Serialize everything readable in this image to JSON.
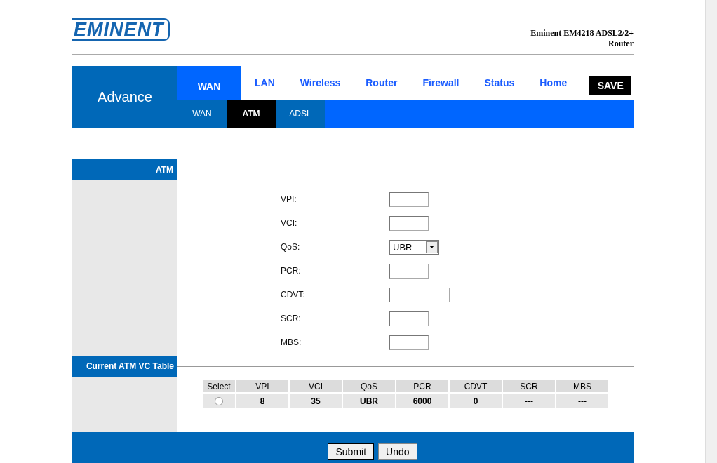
{
  "logo": "EMINENT",
  "product_title": "Eminent EM4218 ADSL2/2+ Router",
  "section_label": "Advance",
  "tabs": [
    {
      "label": "WAN",
      "selected": true
    },
    {
      "label": "LAN",
      "selected": false
    },
    {
      "label": "Wireless",
      "selected": false
    },
    {
      "label": "Router",
      "selected": false
    },
    {
      "label": "Firewall",
      "selected": false
    },
    {
      "label": "Status",
      "selected": false
    },
    {
      "label": "Home",
      "selected": false
    }
  ],
  "save_button": "SAVE",
  "subtabs": [
    {
      "label": "WAN",
      "selected": false
    },
    {
      "label": "ATM",
      "selected": true
    },
    {
      "label": "ADSL",
      "selected": false
    }
  ],
  "atm_section": {
    "title": "ATM",
    "fields": [
      {
        "label": "VPI:",
        "kind": "text"
      },
      {
        "label": "VCI:",
        "kind": "text"
      },
      {
        "label": "QoS:",
        "kind": "select",
        "value": "UBR"
      },
      {
        "label": "PCR:",
        "kind": "text"
      },
      {
        "label": "CDVT:",
        "kind": "text"
      },
      {
        "label": "SCR:",
        "kind": "text"
      },
      {
        "label": "MBS:",
        "kind": "text"
      }
    ]
  },
  "vc_table": {
    "title": "Current ATM VC Table",
    "columns": [
      "Select",
      "VPI",
      "VCI",
      "QoS",
      "PCR",
      "CDVT",
      "SCR",
      "MBS"
    ],
    "rows": [
      {
        "selected": false,
        "cells": [
          "",
          "8",
          "35",
          "UBR",
          "6000",
          "0",
          "---",
          "---"
        ]
      }
    ]
  },
  "buttons": [
    "Submit",
    "Undo"
  ]
}
